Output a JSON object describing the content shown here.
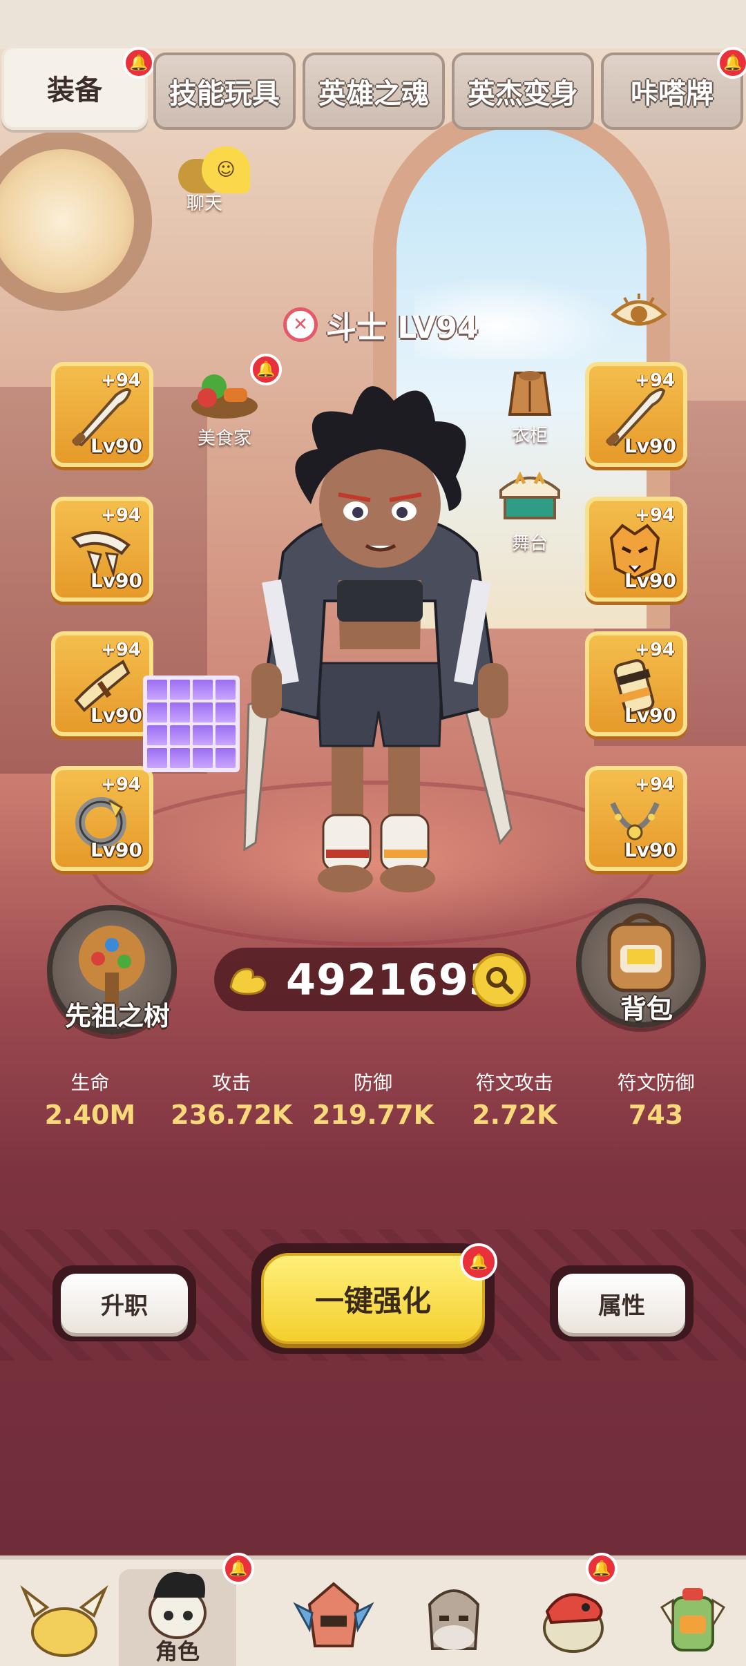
{
  "tabs": [
    {
      "label": "装备",
      "active": true,
      "badge": true
    },
    {
      "label": "技能玩具",
      "active": false,
      "badge": false
    },
    {
      "label": "英雄之魂",
      "active": false,
      "badge": false
    },
    {
      "label": "英杰变身",
      "active": false,
      "badge": false
    },
    {
      "label": "咔嗒牌",
      "active": false,
      "badge": true
    }
  ],
  "chat": {
    "label": "聊天"
  },
  "hero": {
    "class_name": "斗士 LV94"
  },
  "shortcuts": {
    "gourmet": "美食家",
    "wardrobe": "衣柜",
    "stage": "舞台"
  },
  "equipment": {
    "left": [
      {
        "plus": "+94",
        "level": "Lv90",
        "icon": "sword-icon"
      },
      {
        "plus": "+94",
        "level": "Lv90",
        "icon": "fang-boomerang-icon"
      },
      {
        "plus": "+94",
        "level": "Lv90",
        "icon": "horn-icon"
      },
      {
        "plus": "+94",
        "level": "Lv90",
        "icon": "ring-icon"
      }
    ],
    "right": [
      {
        "plus": "+94",
        "level": "Lv90",
        "icon": "sword-icon"
      },
      {
        "plus": "+94",
        "level": "Lv90",
        "icon": "tiger-mask-icon"
      },
      {
        "plus": "+94",
        "level": "Lv90",
        "icon": "bracer-icon"
      },
      {
        "plus": "+94",
        "level": "Lv90",
        "icon": "necklace-icon"
      }
    ]
  },
  "buttons": {
    "ancestor_tree": "先祖之树",
    "backpack": "背包",
    "promote": "升职",
    "one_click_enhance": "一键强化",
    "attributes": "属性"
  },
  "power": {
    "value": "4921693"
  },
  "stats": [
    {
      "label": "生命",
      "value": "2.40M"
    },
    {
      "label": "攻击",
      "value": "236.72K"
    },
    {
      "label": "防御",
      "value": "219.77K"
    },
    {
      "label": "符文攻击",
      "value": "2.72K"
    },
    {
      "label": "符文防御",
      "value": "743"
    }
  ],
  "bottom_nav": [
    {
      "label": "",
      "icon": "horned-helmet-icon",
      "active": false,
      "badge": false
    },
    {
      "label": "角色",
      "icon": "hero-portrait-icon",
      "active": true,
      "badge": true
    },
    {
      "label": "",
      "icon": "tribal-mask-icon",
      "active": false,
      "badge": false
    },
    {
      "label": "",
      "icon": "elder-icon",
      "active": false,
      "badge": false
    },
    {
      "label": "",
      "icon": "dino-icon",
      "active": false,
      "badge": true
    },
    {
      "label": "",
      "icon": "totem-icon",
      "active": false,
      "badge": false
    }
  ],
  "colors": {
    "slot": "#f0b03c",
    "main_button": "#f6db3e",
    "stat_value": "#f8d97a",
    "badge": "#e8313b"
  }
}
